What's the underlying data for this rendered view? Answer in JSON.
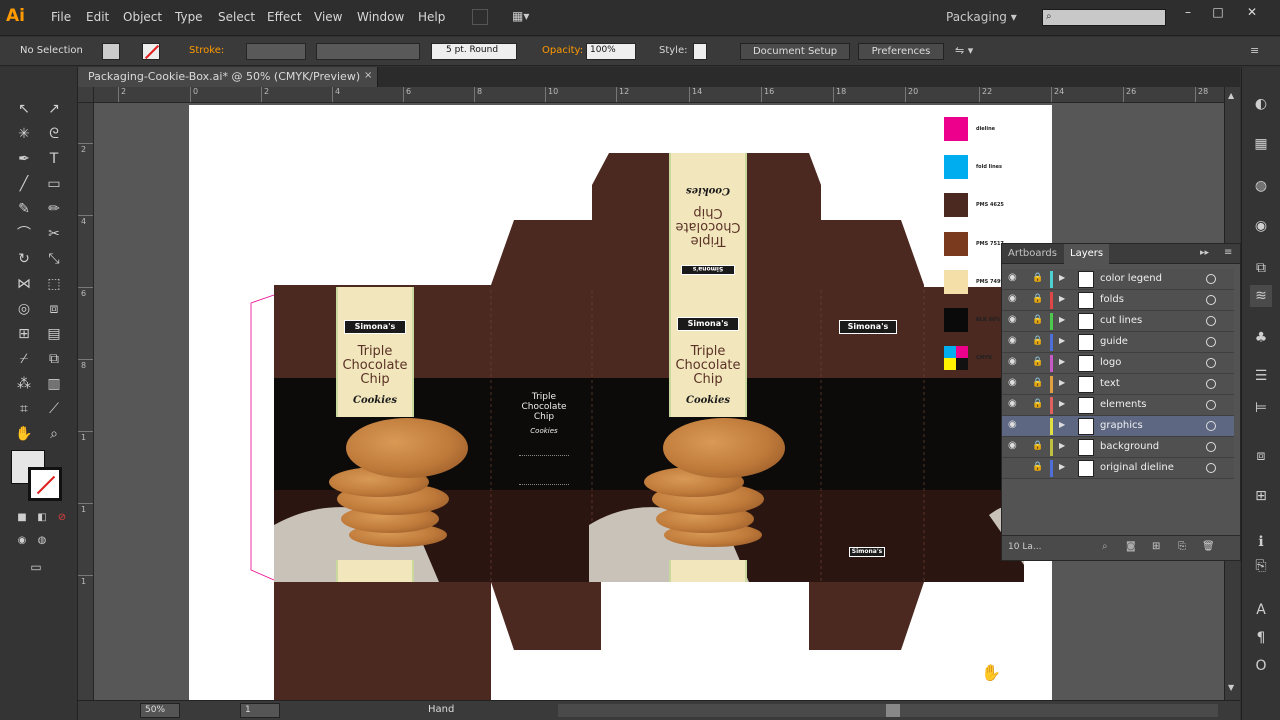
{
  "app": {
    "logo": "Ai",
    "workspace": "Packaging ▾"
  },
  "menu": [
    "File",
    "Edit",
    "Object",
    "Type",
    "Select",
    "Effect",
    "View",
    "Window",
    "Help"
  ],
  "control": {
    "selection": "No Selection",
    "stroke_label": "Stroke:",
    "brush": "5 pt. Round",
    "opacity_label": "Opacity:",
    "opacity": "100%",
    "style_label": "Style:",
    "document_setup": "Document Setup",
    "preferences": "Preferences"
  },
  "document": {
    "tab_title": "Packaging-Cookie-Box.ai* @ 50% (CMYK/Preview)",
    "close": "×"
  },
  "ruler": {
    "h_ticks": [
      "2",
      "0",
      "2",
      "4",
      "6",
      "8",
      "10",
      "12",
      "14",
      "16",
      "18",
      "20",
      "22",
      "24",
      "26",
      "28"
    ],
    "v_ticks": [
      "2",
      "4",
      "6",
      "8",
      "1",
      "1",
      "1"
    ]
  },
  "legend": [
    {
      "label": "dieline",
      "color": "#ec008c"
    },
    {
      "label": "fold lines",
      "color": "#00aeef"
    },
    {
      "label": "PMS 4625",
      "color": "#4b2820"
    },
    {
      "label": "PMS 7517",
      "color": "#7a3a1e"
    },
    {
      "label": "PMS 7499",
      "color": "#f4dfa8"
    },
    {
      "label": "BLK 80%",
      "color": "#0a0a0a"
    },
    {
      "label": "CMYK",
      "color": "#ec008c"
    }
  ],
  "box": {
    "brand": "Simona's",
    "title_lines": [
      "Triple",
      "Chocolate",
      "Chip"
    ],
    "script": "Cookies",
    "side_text_lines": [
      "Triple",
      "Chocolate",
      "Chip"
    ],
    "side_script": "Cookies",
    "side_small": "Simona's"
  },
  "layers_panel": {
    "tabs": [
      "Artboards",
      "Layers"
    ],
    "layers": [
      {
        "name": "color legend",
        "color": "#4ed0d0",
        "locked": true,
        "visible": true,
        "selected": false
      },
      {
        "name": "folds",
        "color": "#e04646",
        "locked": true,
        "visible": true,
        "selected": false
      },
      {
        "name": "cut lines",
        "color": "#4cc84c",
        "locked": true,
        "visible": true,
        "selected": false
      },
      {
        "name": "guide",
        "color": "#4f6fd8",
        "locked": true,
        "visible": true,
        "selected": false
      },
      {
        "name": "logo",
        "color": "#c85ac8",
        "locked": true,
        "visible": true,
        "selected": false
      },
      {
        "name": "text",
        "color": "#e0a040",
        "locked": true,
        "visible": true,
        "selected": false
      },
      {
        "name": "elements",
        "color": "#e06060",
        "locked": true,
        "visible": true,
        "selected": false
      },
      {
        "name": "graphics",
        "color": "#e0e040",
        "locked": false,
        "visible": true,
        "selected": true
      },
      {
        "name": "background",
        "color": "#c0c040",
        "locked": true,
        "visible": true,
        "selected": false
      },
      {
        "name": "original dieline",
        "color": "#4f6fd8",
        "locked": true,
        "visible": false,
        "selected": false
      }
    ],
    "footer_count": "10 La..."
  },
  "status": {
    "zoom": "50%",
    "artboard": "1",
    "tool": "Hand"
  },
  "colors": {
    "accent": "#ff9a00",
    "brown": "#4b2820",
    "cream": "#f2e6bd"
  }
}
